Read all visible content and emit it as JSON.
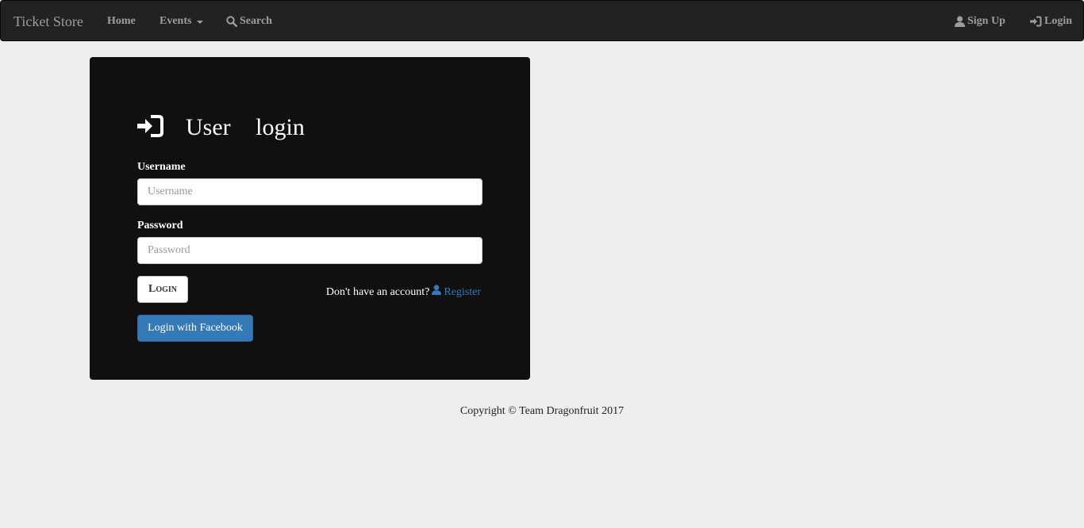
{
  "navbar": {
    "brand": "Ticket Store",
    "home": "Home",
    "events": "Events",
    "search": "Search",
    "sign_up": "Sign Up",
    "login": "Login"
  },
  "login_panel": {
    "title": "User login",
    "username_label": "Username",
    "username_placeholder": "Username",
    "password_label": "Password",
    "password_placeholder": "Password",
    "login_button": "Login",
    "no_account_text": "Don't have an account?",
    "register_link": "Register",
    "facebook_button": "Login with Facebook"
  },
  "footer": {
    "copyright": "Copyright © Team Dragonfruit 2017"
  },
  "colors": {
    "navbar_bg": "#222222",
    "nav_text": "#9d9d9d",
    "panel_bg": "#101010",
    "page_bg": "#eeeeee",
    "primary": "#337ab7"
  },
  "icons": {
    "search": "search-icon",
    "user": "user-icon",
    "login": "log-in-icon"
  }
}
